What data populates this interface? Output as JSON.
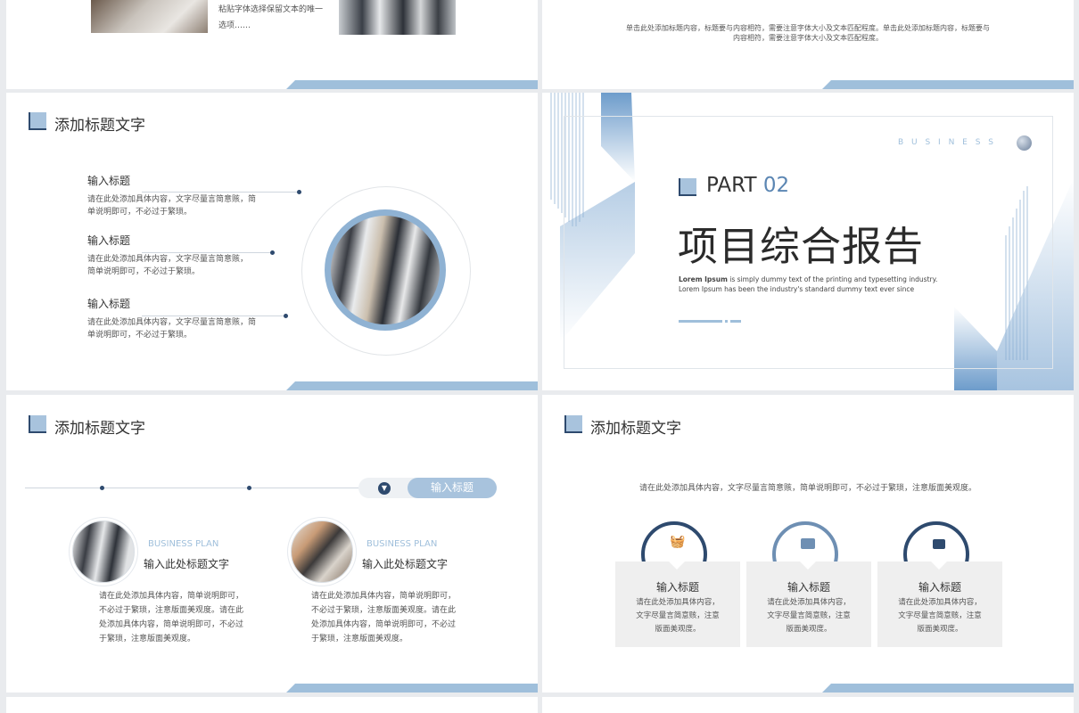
{
  "slide1": {
    "text_line1": "粘贴字体选择保留文本的唯一",
    "text_line2": "选项……"
  },
  "slide2": {
    "text_line1": "单击此处添加标题内容，标题要与内容相符，需要注意字体大小及文本匹配程度。单击此处添加标题内容，标题要与",
    "text_line2": "内容相符，需要注意字体大小及文本匹配程度。"
  },
  "slide3": {
    "title": "添加标题文字",
    "items": [
      {
        "heading": "输入标题",
        "body1": "请在此处添加具体内容，文字尽量言简意赅，简",
        "body2": "单说明即可，不必过于繁琐。"
      },
      {
        "heading": "输入标题",
        "body1": "请在此处添加具体内容，文字尽量言简意赅，",
        "body2": "简单说明即可，不必过于繁琐。"
      },
      {
        "heading": "输入标题",
        "body1": "请在此处添加具体内容，文字尽量言简意赅，简",
        "body2": "单说明即可，不必过于繁琐。"
      }
    ]
  },
  "slide4": {
    "brand": "B U S I N E S S",
    "part_label": "PART",
    "part_num": "02",
    "main_title": "项目综合报告",
    "lorem_bold": "Lorem Ipsum",
    "lorem_rest": " is simply dummy text of the printing and typesetting industry.",
    "lorem_line2": "Lorem Ipsum has been the industry's standard dummy text ever since"
  },
  "slide5": {
    "title": "添加标题文字",
    "pill_label": "输入标题",
    "cards": [
      {
        "kicker": "BUSINESS PLAN",
        "heading": "输入此处标题文字",
        "lines": [
          "请在此处添加具体内容，简单说明即可，",
          "不必过于繁琐，注意版面美观度。请在此",
          "处添加具体内容，简单说明即可，不必过",
          "于繁琐，注意版面美观度。"
        ]
      },
      {
        "kicker": "BUSINESS PLAN",
        "heading": "输入此处标题文字",
        "lines": [
          "请在此处添加具体内容，简单说明即可，",
          "不必过于繁琐，注意版面美观度。请在此",
          "处添加具体内容，简单说明即可，不必过",
          "于繁琐，注意版面美观度。"
        ]
      }
    ]
  },
  "slide6": {
    "title": "添加标题文字",
    "subtitle": "请在此处添加具体内容，文字尽量言简意赅，简单说明即可，不必过于繁琐，注意版面美观度。",
    "cards": [
      {
        "icon": "basket-icon",
        "heading": "输入标题",
        "lines": [
          "请在此处添加具体内容，",
          "文字尽量言简意赅，注意",
          "版面美观度。"
        ]
      },
      {
        "icon": "chat-icon",
        "heading": "输入标题",
        "lines": [
          "请在此处添加具体内容，",
          "文字尽量言简意赅，注意",
          "版面美观度。"
        ]
      },
      {
        "icon": "briefcase-icon",
        "heading": "输入标题",
        "lines": [
          "请在此处添加具体内容，",
          "文字尽量言简意赅，注意",
          "版面美观度。"
        ]
      }
    ]
  },
  "colors": {
    "accent": "#9fbfdb",
    "dark": "#2e4a6e"
  }
}
